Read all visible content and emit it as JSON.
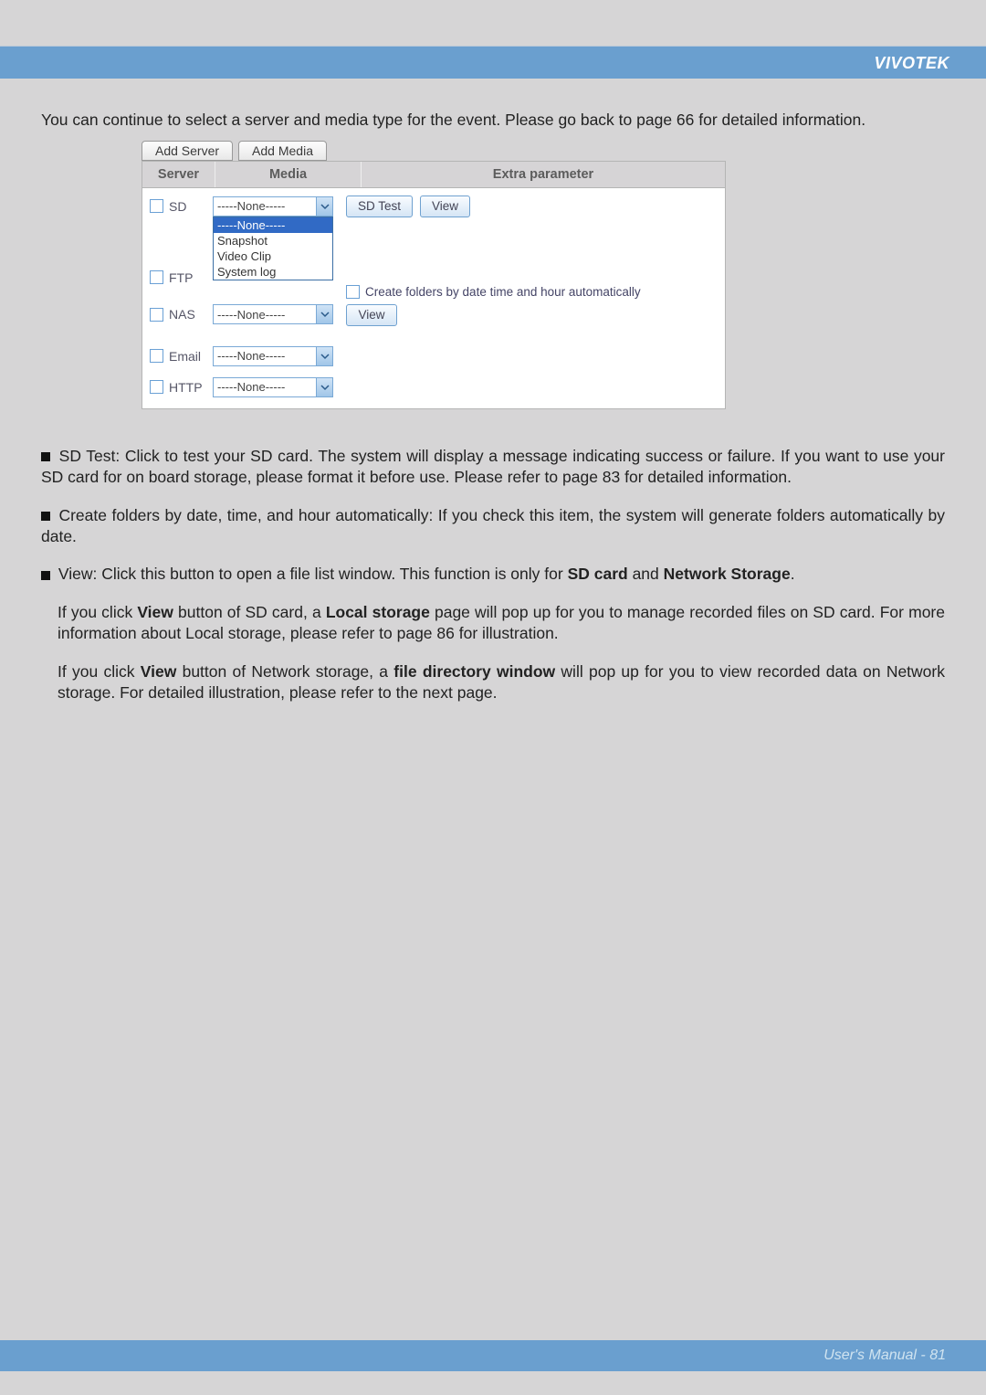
{
  "brand": "VIVOTEK",
  "intro": "You can continue to select a server and media type for the event. Please go back to page 66 for detailed information.",
  "panel": {
    "tab_add_server": "Add Server",
    "tab_add_media": "Add Media",
    "header_server": "Server",
    "header_media": "Media",
    "header_extra": "Extra parameter",
    "none_placeholder": "-----None-----",
    "servers": {
      "sd": "SD",
      "ftp": "FTP",
      "nas": "NAS",
      "email": "Email",
      "http": "HTTP"
    },
    "dropdown_options": [
      "-----None-----",
      "Snapshot",
      "Video Clip",
      "System log"
    ],
    "sd_buttons": {
      "test": "SD Test",
      "view": "View"
    },
    "nas": {
      "create_label": "Create folders by date time and hour automatically",
      "view": "View"
    }
  },
  "paragraphs": {
    "p1_a": "SD Test: Click to test your SD card. The system will display a message indicating success or failure. If you want to use your SD card for on board storage, please format it before use. Please refer to page 83 for detailed information.",
    "p2_a": "Create folders by date, time, and hour automatically: If you check this item, the system will generate folders automatically by date.",
    "p3_a": "View: Click this button to open a file list window. This function is only for ",
    "p3_b": "SD card",
    "p3_c": " and ",
    "p3_d": "Network Storage",
    "p3_e": ".",
    "p4_a": "If you click ",
    "p4_b": "View",
    "p4_c": " button of SD card, a ",
    "p4_d": "Local storage",
    "p4_e": " page will pop up for you to manage recorded files on SD card. For more information about Local storage, please refer to page 86 for illustration.",
    "p5_a": "If you click ",
    "p5_b": "View",
    "p5_c": " button of Network storage, a ",
    "p5_d": "file directory window",
    "p5_e": " will pop up for you to view recorded data on Network storage. For detailed illustration, please refer to the next page."
  },
  "footer": {
    "label": "User's Manual - ",
    "page": "81"
  }
}
